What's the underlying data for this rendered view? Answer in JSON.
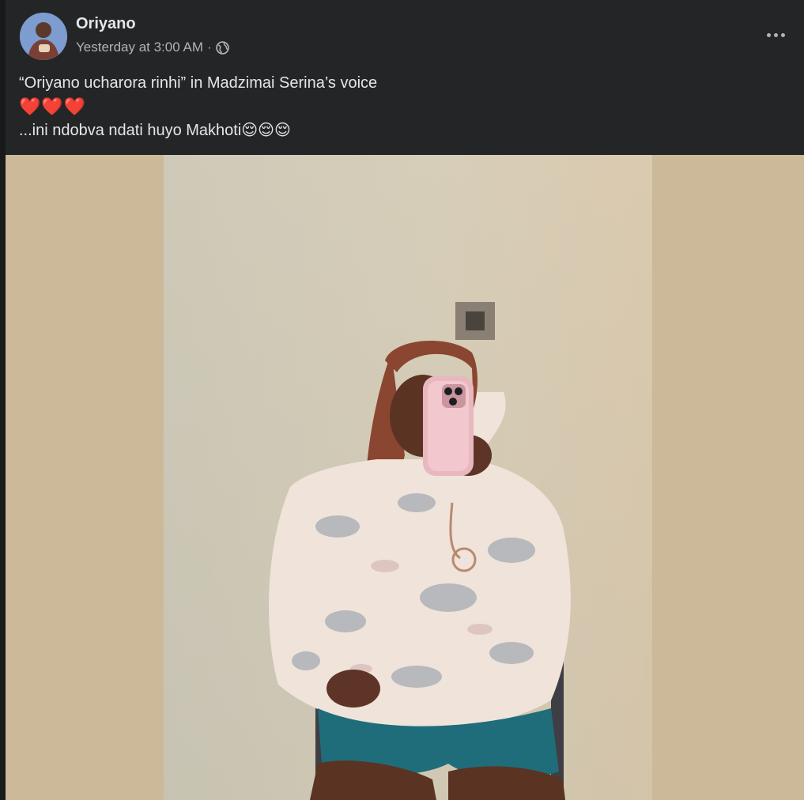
{
  "post": {
    "author": "Oriyano",
    "timestamp": "Yesterday at 3:00 AM",
    "separator": "·",
    "audience_icon": "globe-icon",
    "more_icon": "more-options-icon",
    "text_lines": [
      "“Oriyano ucharora rinhi” in Madzimai Serina’s voice",
      "❤️❤️❤️",
      "...ini ndobva ndati huyo Makhoti😌😌😌"
    ]
  },
  "colors": {
    "post_background": "#242526",
    "primary_text": "#e4e6eb",
    "secondary_text": "#b0b3b8",
    "photo_side_fill": "#cbb999"
  }
}
